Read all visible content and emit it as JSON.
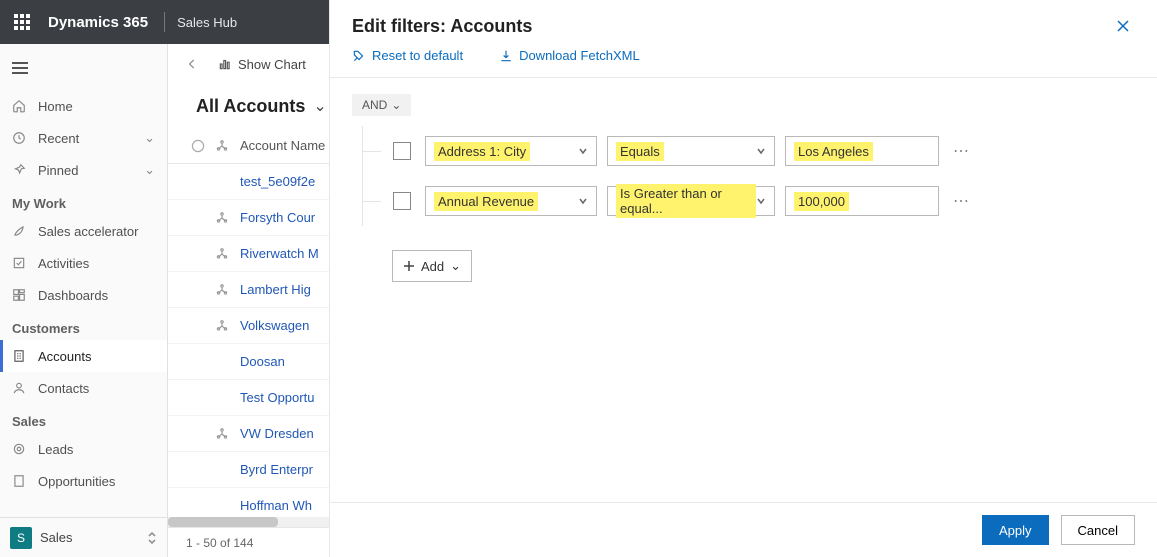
{
  "header": {
    "product": "Dynamics 365",
    "app": "Sales Hub"
  },
  "sidebar": {
    "items": [
      {
        "label": "Home"
      },
      {
        "label": "Recent"
      },
      {
        "label": "Pinned"
      }
    ],
    "groups": [
      {
        "title": "My Work",
        "items": [
          {
            "label": "Sales accelerator"
          },
          {
            "label": "Activities"
          },
          {
            "label": "Dashboards"
          }
        ]
      },
      {
        "title": "Customers",
        "items": [
          {
            "label": "Accounts"
          },
          {
            "label": "Contacts"
          }
        ]
      },
      {
        "title": "Sales",
        "items": [
          {
            "label": "Leads"
          },
          {
            "label": "Opportunities"
          }
        ]
      }
    ],
    "footer": {
      "badge": "S",
      "label": "Sales"
    }
  },
  "grid": {
    "show_chart": "Show Chart",
    "view_name": "All Accounts",
    "column_header": "Account Name",
    "rows": [
      {
        "name": "test_5e09f2e",
        "hier": false
      },
      {
        "name": "Forsyth Cour",
        "hier": true
      },
      {
        "name": "Riverwatch M",
        "hier": true
      },
      {
        "name": "Lambert Hig",
        "hier": true
      },
      {
        "name": "Volkswagen",
        "hier": true
      },
      {
        "name": "Doosan",
        "hier": false
      },
      {
        "name": "Test Opportu",
        "hier": false
      },
      {
        "name": "VW Dresden",
        "hier": true
      },
      {
        "name": "Byrd Enterpr",
        "hier": false
      },
      {
        "name": "Hoffman Wh",
        "hier": false
      }
    ],
    "paging": "1 - 50 of 144"
  },
  "panel": {
    "title": "Edit filters: Accounts",
    "reset": "Reset to default",
    "download": "Download FetchXML",
    "group_op": "AND",
    "filters": [
      {
        "field": "Address 1: City",
        "operator": "Equals",
        "value": "Los Angeles"
      },
      {
        "field": "Annual Revenue",
        "operator": "Is Greater than or equal...",
        "value": "100,000"
      }
    ],
    "add": "Add",
    "apply": "Apply",
    "cancel": "Cancel"
  }
}
